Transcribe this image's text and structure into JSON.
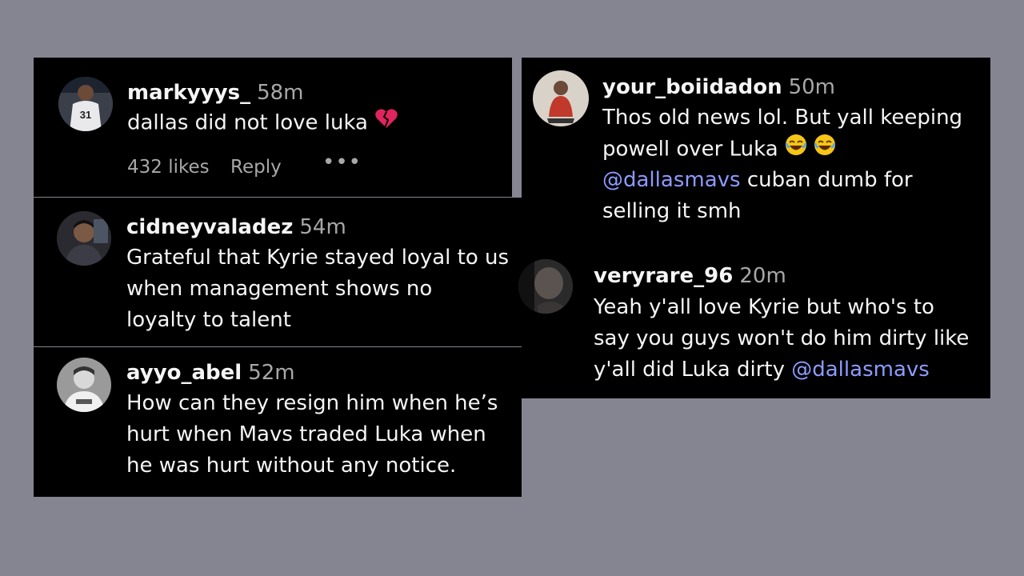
{
  "colors": {
    "background": "#858491",
    "panel": "#000000",
    "text": "#f5f5f5",
    "muted": "#a8a8a8",
    "mention": "#8d9bff",
    "heart": "#e0245e"
  },
  "comments": [
    {
      "username": "markyyys_",
      "time": "58m",
      "text": "dallas did not love luka",
      "emoji": "broken-heart",
      "likes": "432 likes",
      "reply": "Reply",
      "more": "•••"
    },
    {
      "username": "cidneyvaladez",
      "time": "54m",
      "lines": [
        "Grateful that Kyrie stayed loyal to us",
        "when management shows no",
        "loyalty to talent"
      ]
    },
    {
      "username": "ayyo_abel",
      "time": "52m",
      "lines": [
        "How can they resign him when he’s",
        "hurt when Mavs traded Luka when",
        "he was hurt without any notice."
      ]
    },
    {
      "username": "your_boiidadon",
      "time": "50m",
      "line1": "Thos old news lol. But yall keeping",
      "line2": "powell over Luka",
      "line3_mention": "@dallasmavs",
      "line3_rest": " cuban dumb for",
      "line4": "selling it smh"
    },
    {
      "username": "veryrare_96",
      "time": "20m",
      "line1": "Yeah y'all love Kyrie but who's to",
      "line2": "say you guys won't do him dirty like",
      "line3": "y'all did Luka dirty ",
      "line3_mention": "@dallasmavs"
    }
  ]
}
